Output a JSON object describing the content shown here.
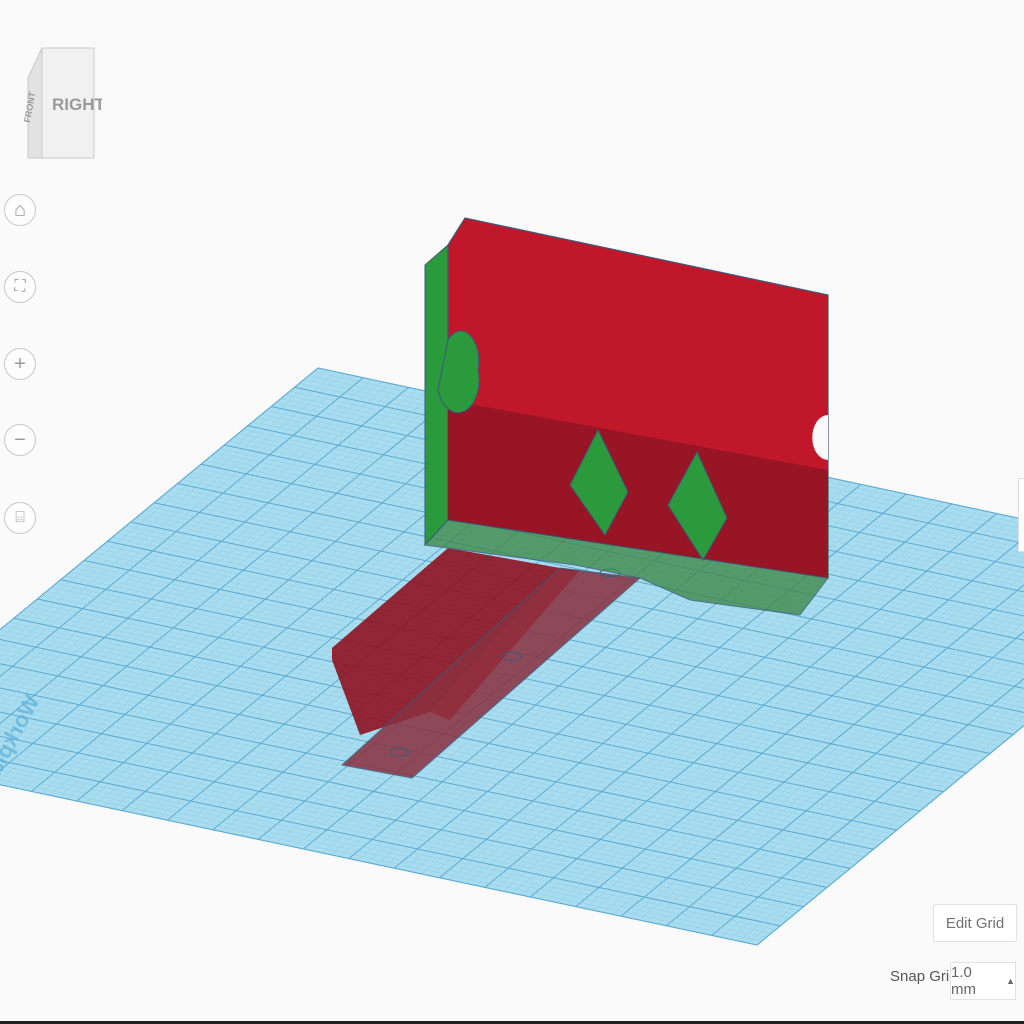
{
  "viewcube": {
    "front_label": "FRONT",
    "right_label": "RIGHT"
  },
  "nav": [
    {
      "name": "home-view",
      "icon": "home-icon"
    },
    {
      "name": "fit-view",
      "icon": "fit-icon"
    },
    {
      "name": "zoom-in",
      "icon": "plus-icon"
    },
    {
      "name": "zoom-out",
      "icon": "minus-icon"
    },
    {
      "name": "ortho-view",
      "icon": "perspective-icon"
    }
  ],
  "workplane": {
    "label": "Workplane"
  },
  "grid": {
    "edit_label": "Edit Grid",
    "snap_label": "Snap Grid",
    "snap_value": "1.0 mm",
    "snap_arrow": "▲"
  },
  "colors": {
    "shape_red": "#c0182a",
    "shape_green": "#2b9a3c",
    "plane": "#a9dcef",
    "grid_line": "#6fbde0"
  }
}
